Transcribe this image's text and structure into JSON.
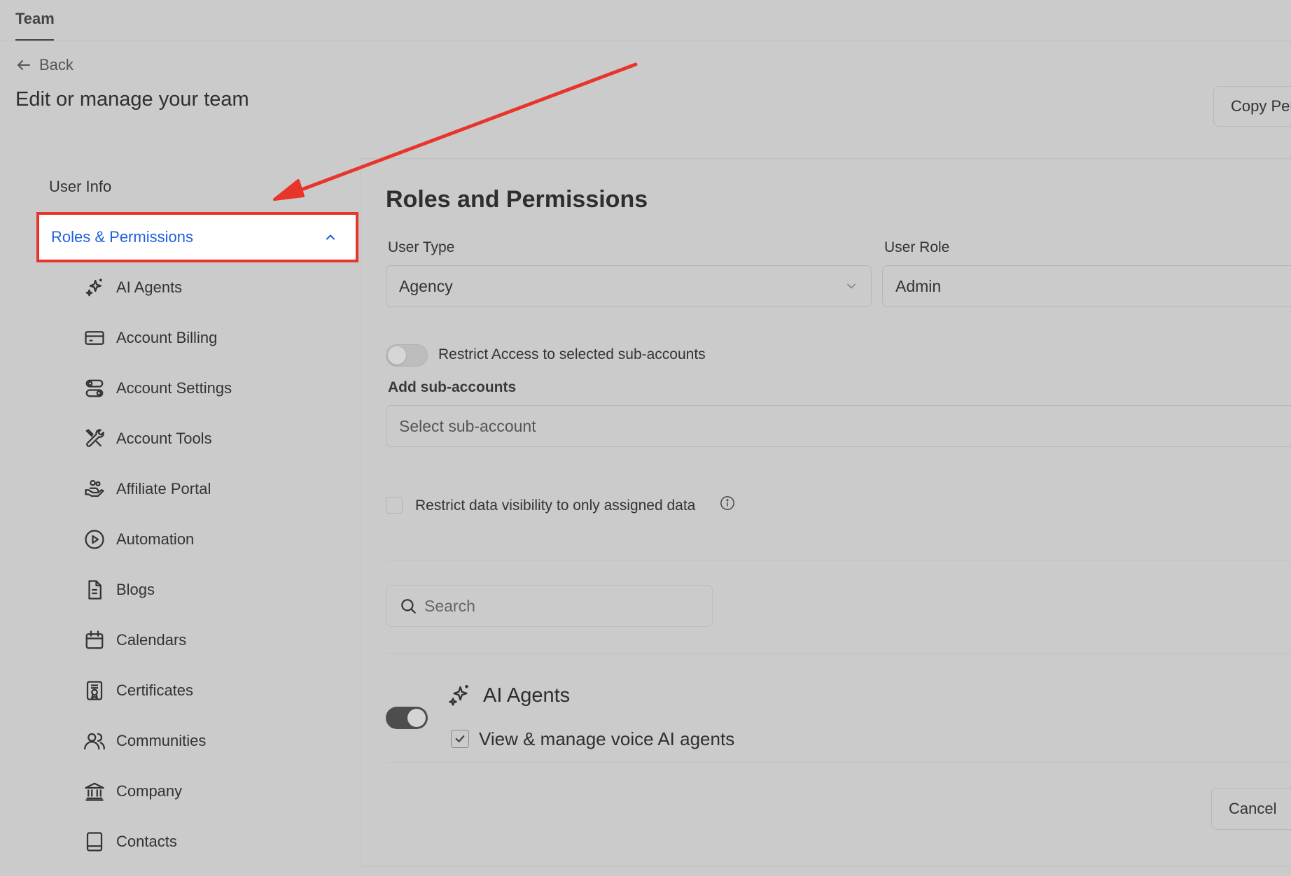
{
  "header": {
    "tab": "Team",
    "back_label": "Back",
    "page_title": "Edit or manage your team",
    "copy_button": "Copy Per"
  },
  "sidebar": {
    "user_info": "User Info",
    "active_section": "Roles & Permissions",
    "items": [
      {
        "label": "AI Agents",
        "icon": "sparkle-icon"
      },
      {
        "label": "Account Billing",
        "icon": "credit-card-icon"
      },
      {
        "label": "Account Settings",
        "icon": "toggles-icon"
      },
      {
        "label": "Account Tools",
        "icon": "tools-icon"
      },
      {
        "label": "Affiliate Portal",
        "icon": "hand-users-icon"
      },
      {
        "label": "Automation",
        "icon": "play-circle-icon"
      },
      {
        "label": "Blogs",
        "icon": "document-icon"
      },
      {
        "label": "Calendars",
        "icon": "calendar-icon"
      },
      {
        "label": "Certificates",
        "icon": "certificate-icon"
      },
      {
        "label": "Communities",
        "icon": "users-icon"
      },
      {
        "label": "Company",
        "icon": "bank-icon"
      },
      {
        "label": "Contacts",
        "icon": "book-icon"
      }
    ]
  },
  "main": {
    "section_title": "Roles and Permissions",
    "user_type_label": "User Type",
    "user_type_value": "Agency",
    "user_role_label": "User Role",
    "user_role_value": "Admin",
    "restrict_access_label": "Restrict Access to selected sub-accounts",
    "restrict_access_on": false,
    "add_subaccounts_label": "Add sub-accounts",
    "subaccount_placeholder": "Select sub-account",
    "restrict_visibility_label": "Restrict data visibility to only assigned data",
    "restrict_visibility_checked": false,
    "search_placeholder": "Search",
    "permission_group": {
      "title": "AI Agents",
      "enabled": true,
      "permission": "View & manage voice AI agents",
      "permission_checked": true
    },
    "cancel_button": "Cancel"
  },
  "colors": {
    "active_link": "#1f5fe0",
    "highlight_box": "#e8352b",
    "background": "#cbcbcb"
  }
}
